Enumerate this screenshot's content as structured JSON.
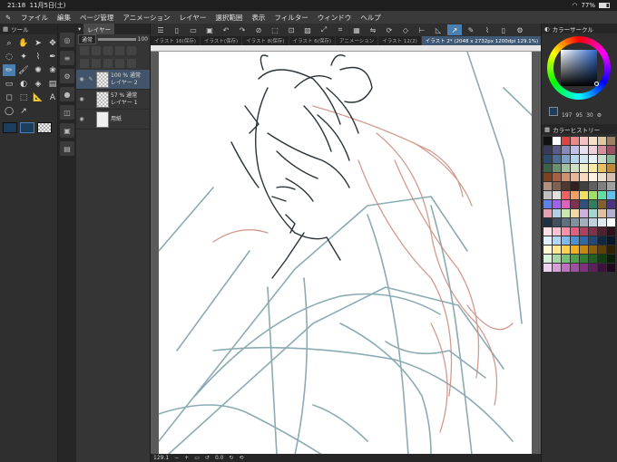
{
  "status": {
    "time": "21:18",
    "date": "11月5日(土)",
    "battery": "77%"
  },
  "menu": [
    "ファイル",
    "編集",
    "ページ管理",
    "アニメーション",
    "レイヤー",
    "選択範囲",
    "表示",
    "フィルター",
    "ウィンドウ",
    "ヘルプ"
  ],
  "tool_panel": {
    "title": "ツール"
  },
  "layer_panel": {
    "tab": "レイヤー",
    "blend_mode": "通常",
    "opacity": "100",
    "layers": [
      {
        "opacity": "100 % 通常",
        "name": "レイヤー 2",
        "selected": true
      },
      {
        "opacity": "57 % 通常",
        "name": "レイヤー 1",
        "selected": false
      },
      {
        "opacity": "",
        "name": "用紙",
        "selected": false
      }
    ]
  },
  "doc_tabs": [
    {
      "label": "イラスト 16(保存)",
      "active": false
    },
    {
      "label": "イラスト(保存)",
      "active": false
    },
    {
      "label": "イラスト 8(保存)",
      "active": false
    },
    {
      "label": "イラスト 6(保存)",
      "active": false
    },
    {
      "label": "アニメーション",
      "active": false
    },
    {
      "label": "イラスト 12(2)",
      "active": false
    },
    {
      "label": "イラスト 2* (2048 x 2732px 1200dpi 129.1%)",
      "active": true
    }
  ],
  "bottom": {
    "zoom": "129.1",
    "angle": "0.0"
  },
  "color_panel": {
    "wheel_title": "カラーサークル",
    "values": [
      "197",
      "95",
      "30"
    ],
    "history_title": "カラーヒストリー"
  },
  "colors": {
    "accent": "#4a7fb0",
    "sketch_teal": "#7fa3ab",
    "sketch_red": "#c98a7c",
    "sketch_dark": "#2a3338",
    "main_color": "#1d3d5c"
  },
  "palette_colors": [
    "#111111",
    "#ffffff",
    "#d44",
    "#e88",
    "#f5c0c0",
    "#f4e2c8",
    "#e0c8a0",
    "#a08060",
    "#3a3a5a",
    "#5a5a8a",
    "#8888bb",
    "#c0c0e8",
    "#e8e0f0",
    "#f0d0d8",
    "#d890a0",
    "#a05060",
    "#2d4a6a",
    "#4a6e96",
    "#7aa0c8",
    "#b8d4ec",
    "#d0e8f0",
    "#e8f4f8",
    "#c8e0d0",
    "#88b898",
    "#3c6048",
    "#6a9070",
    "#a0c0a0",
    "#d0e0c0",
    "#f0f0c8",
    "#f8e8a0",
    "#e8c060",
    "#c08830",
    "#804020",
    "#a86040",
    "#d09070",
    "#e8b898",
    "#f8d8c0",
    "#fff0e0",
    "#f0e0d0",
    "#d8c0b0",
    "#b09080",
    "#806050",
    "#503830",
    "#302020",
    "#404040",
    "#606060",
    "#808080",
    "#a0a0a0",
    "#c0c0c0",
    "#e0e0e0",
    "#f06060",
    "#f0a060",
    "#f0e060",
    "#a0e060",
    "#60e0a0",
    "#60c0f0",
    "#6080f0",
    "#a060f0",
    "#e060c0",
    "#803050",
    "#305080",
    "#308060",
    "#806030",
    "#503080",
    "#e8a0b0",
    "#b0d0e8",
    "#c8e8b0",
    "#f0d8a0",
    "#d0b0e0",
    "#a0d8d0",
    "#e0c0a0",
    "#b0b0d0",
    "#203040",
    "#405060",
    "#607080",
    "#8090a0",
    "#a0b0c0",
    "#c0d0e0",
    "#e0e8f0",
    "#f8fcff",
    "#ffe0e8",
    "#ffc0d0",
    "#ff90a8",
    "#e06080",
    "#b04060",
    "#803048",
    "#502030",
    "#301018",
    "#e0f0ff",
    "#b0d8ff",
    "#80b8f0",
    "#5090d0",
    "#3068a8",
    "#204878",
    "#102848",
    "#081828",
    "#fff8d0",
    "#ffe890",
    "#ffd050",
    "#f0b020",
    "#c88810",
    "#906008",
    "#604004",
    "#302002",
    "#d8f0d8",
    "#a8d8a8",
    "#78c078",
    "#50a050",
    "#308030",
    "#206020",
    "#104010",
    "#082008",
    "#f0d0f0",
    "#d8a0d8",
    "#c070c0",
    "#a050a0",
    "#803080",
    "#602060",
    "#401040",
    "#200820"
  ]
}
